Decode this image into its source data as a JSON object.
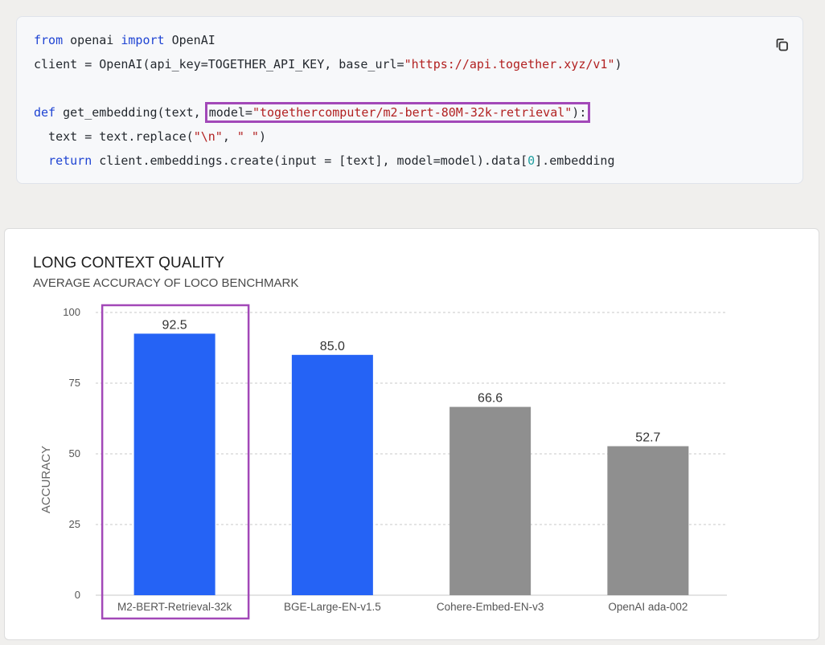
{
  "code": {
    "lines": [
      [
        {
          "t": "from",
          "c": "kw"
        },
        {
          "t": " openai "
        },
        {
          "t": "import",
          "c": "kw"
        },
        {
          "t": " OpenAI"
        }
      ],
      [
        {
          "t": "client = OpenAI(api_key=TOGETHER_API_KEY, base_url="
        },
        {
          "t": "\"https://api.together.xyz/v1\"",
          "c": "str"
        },
        {
          "t": ")"
        }
      ],
      [],
      [
        {
          "t": "def",
          "c": "kw"
        },
        {
          "t": " get_embedding(text, "
        },
        {
          "box": true,
          "parts": [
            {
              "t": "model="
            },
            {
              "t": "\"togethercomputer/m2-bert-80M-32k-retrieval\"",
              "c": "str"
            },
            {
              "t": "):"
            }
          ]
        }
      ],
      [
        {
          "t": "  text = text.replace("
        },
        {
          "t": "\"\\n\"",
          "c": "str"
        },
        {
          "t": ", "
        },
        {
          "t": "\" \"",
          "c": "str"
        },
        {
          "t": ")"
        }
      ],
      [
        {
          "t": "  "
        },
        {
          "t": "return",
          "c": "kw"
        },
        {
          "t": " client.embeddings.create(input = [text], model=model).data["
        },
        {
          "t": "0",
          "c": "num"
        },
        {
          "t": "].embedding"
        }
      ]
    ]
  },
  "copy_icon": "copy-icon",
  "colors": {
    "accent": "#2563f5",
    "muted_bar": "#8f8f8f",
    "highlight": "#a248b8"
  },
  "chart_data": {
    "type": "bar",
    "title": "LONG CONTEXT QUALITY",
    "subtitle": "AVERAGE ACCURACY OF LOCO BENCHMARK",
    "xlabel": "",
    "ylabel": "ACCURACY",
    "ylim": [
      0,
      100
    ],
    "yticks": [
      0,
      25,
      50,
      75,
      100
    ],
    "grid": true,
    "categories": [
      "M2-BERT-Retrieval-32k",
      "BGE-Large-EN-v1.5",
      "Cohere-Embed-EN-v3",
      "OpenAI ada-002"
    ],
    "values": [
      92.5,
      85.0,
      66.6,
      52.7
    ],
    "value_labels": [
      "92.5",
      "85.0",
      "66.6",
      "52.7"
    ],
    "bar_colors": [
      "#2563f5",
      "#2563f5",
      "#8f8f8f",
      "#8f8f8f"
    ],
    "highlighted_category": "M2-BERT-Retrieval-32k"
  }
}
